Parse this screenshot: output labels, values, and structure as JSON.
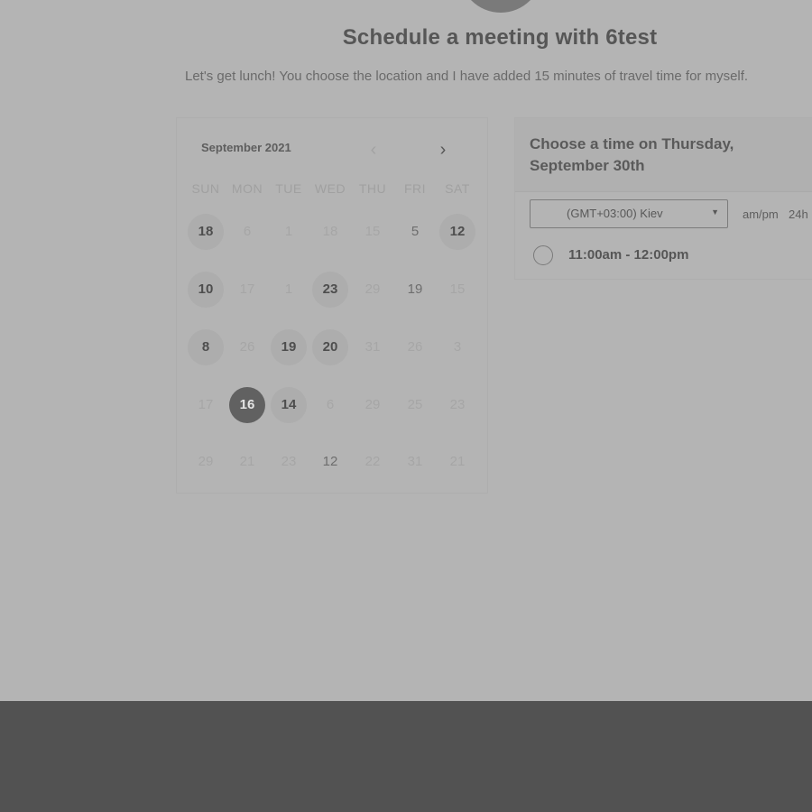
{
  "header": {
    "title": "Schedule a meeting with 6test",
    "subtitle": "Let's get lunch! You choose the location and I have added 15 minutes of travel time for myself."
  },
  "calendar": {
    "month": "September 2021",
    "prev_icon": "chevron-left-icon",
    "next_icon": "chevron-right-icon",
    "prev_glyph": "‹",
    "next_glyph": "›",
    "weekdays": [
      "SUN",
      "MON",
      "TUE",
      "WED",
      "THU",
      "FRI",
      "SAT"
    ],
    "weeks": [
      [
        {
          "d": "18",
          "s": "avail"
        },
        {
          "d": "6",
          "s": "na"
        },
        {
          "d": "1",
          "s": "na"
        },
        {
          "d": "18",
          "s": "na"
        },
        {
          "d": "15",
          "s": "na"
        },
        {
          "d": "5",
          "s": "dim"
        },
        {
          "d": "12",
          "s": "avail"
        }
      ],
      [
        {
          "d": "10",
          "s": "avail"
        },
        {
          "d": "17",
          "s": "na"
        },
        {
          "d": "1",
          "s": "na"
        },
        {
          "d": "23",
          "s": "avail"
        },
        {
          "d": "29",
          "s": "na"
        },
        {
          "d": "19",
          "s": "dim"
        },
        {
          "d": "15",
          "s": "na"
        }
      ],
      [
        {
          "d": "8",
          "s": "avail"
        },
        {
          "d": "26",
          "s": "na"
        },
        {
          "d": "19",
          "s": "avail"
        },
        {
          "d": "20",
          "s": "avail"
        },
        {
          "d": "31",
          "s": "na"
        },
        {
          "d": "26",
          "s": "na"
        },
        {
          "d": "3",
          "s": "na"
        }
      ],
      [
        {
          "d": "17",
          "s": "na"
        },
        {
          "d": "16",
          "s": "selected"
        },
        {
          "d": "14",
          "s": "avail"
        },
        {
          "d": "6",
          "s": "na"
        },
        {
          "d": "29",
          "s": "na"
        },
        {
          "d": "25",
          "s": "na"
        },
        {
          "d": "23",
          "s": "na"
        }
      ],
      [
        {
          "d": "29",
          "s": "na"
        },
        {
          "d": "21",
          "s": "na"
        },
        {
          "d": "23",
          "s": "na"
        },
        {
          "d": "12",
          "s": "dim"
        },
        {
          "d": "22",
          "s": "na"
        },
        {
          "d": "31",
          "s": "na"
        },
        {
          "d": "21",
          "s": "na"
        }
      ]
    ]
  },
  "times": {
    "heading": "Choose a time on Thursday, September 30th",
    "timezone": "(GMT+03:00) Kiev",
    "caret": "▼",
    "format_ampm": "am/pm",
    "format_24h": "24h",
    "slots": [
      {
        "label": "11:00am - 12:00pm"
      }
    ]
  },
  "colors": {
    "overlay_background": "#b4b4b4",
    "footer_band": "#525252",
    "selected_day": "#616161"
  }
}
